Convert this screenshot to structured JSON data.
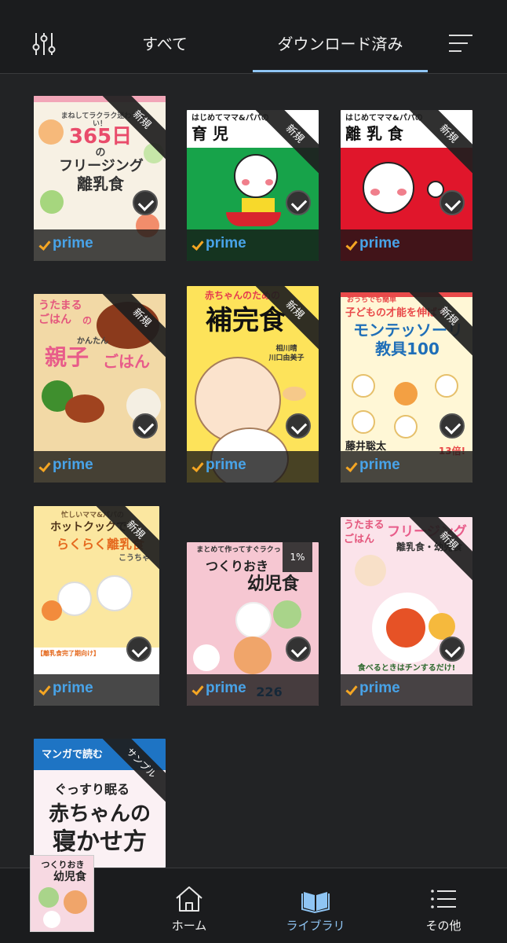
{
  "header": {
    "tabs": [
      {
        "label": "すべて",
        "active": false
      },
      {
        "label": "ダウンロード済み",
        "active": true
      }
    ],
    "accent_color": "#8fc5f4"
  },
  "books": [
    {
      "id": "b1",
      "ribbon": "新規",
      "prime": "prime",
      "downloaded": true,
      "cover_lines": [
        "まねしてラクラク迷わない！",
        "365日",
        "の",
        "フリージング",
        "離乳食"
      ],
      "cover_color": "#f7f1e4"
    },
    {
      "id": "b2",
      "ribbon": "新規",
      "prime": "prime",
      "downloaded": true,
      "cover_lines": [
        "はじめてママ&パパの",
        "育 児"
      ],
      "cover_color": "#17a34a"
    },
    {
      "id": "b3",
      "ribbon": "新規",
      "prime": "prime",
      "downloaded": true,
      "cover_lines": [
        "はじめてママ&パパの",
        "離 乳 食"
      ],
      "cover_color": "#e0162b"
    },
    {
      "id": "b4",
      "ribbon": "新規",
      "prime": "prime",
      "downloaded": true,
      "cover_lines": [
        "うたまる",
        "ごはん",
        "の",
        "かんたん",
        "親子",
        "ごはん"
      ],
      "cover_color": "#f2d9a6"
    },
    {
      "id": "b5",
      "ribbon": "新規",
      "prime": "prime",
      "downloaded": true,
      "cover_lines": [
        "赤ちゃんのための",
        "補完食",
        "相川晴",
        "川口由美子"
      ],
      "cover_color": "#fde35a"
    },
    {
      "id": "b6",
      "ribbon": "新規",
      "prime": "prime",
      "downloaded": true,
      "cover_lines": [
        "おうちでも簡単",
        "子どもの才能を伸ばす",
        "モンテッソーリ",
        "教具100",
        "藤井聡太",
        "13倍!"
      ],
      "cover_color": "#fff7d6"
    },
    {
      "id": "b7",
      "ribbon": "新規",
      "prime": "prime",
      "downloaded": true,
      "cover_lines": [
        "忙しいママ&パパの",
        "ホットクックで",
        "らくらく離乳食",
        "こうちゃ",
        "【離乳食完了期向け】"
      ],
      "cover_color": "#fbe7a0"
    },
    {
      "id": "b8",
      "ribbon": "1%",
      "prime": "prime",
      "downloaded": true,
      "cover_lines": [
        "まとめて作ってすぐラクっ",
        "つくりおき",
        "幼児食",
        "226"
      ],
      "cover_color": "#f6c7d2"
    },
    {
      "id": "b9",
      "ribbon": "新規",
      "prime": "prime",
      "downloaded": true,
      "cover_lines": [
        "うたまる",
        "ごはん",
        "フリージング",
        "離乳食・幼児食",
        "食べるときはチンするだけ!"
      ],
      "cover_color": "#fbe3ea"
    },
    {
      "id": "b10",
      "ribbon": "サンプル",
      "prime": "",
      "downloaded": false,
      "cover_lines": [
        "マンガで読む",
        "ぐっすり眠る",
        "赤ちゃんの",
        "寝かせ方"
      ],
      "cover_color": "#1e74c4"
    }
  ],
  "bottom_nav": {
    "items": [
      {
        "label": "ホーム",
        "icon": "home-icon",
        "active": false
      },
      {
        "label": "ライブラリ",
        "icon": "book-icon",
        "active": true
      },
      {
        "label": "その他",
        "icon": "menu-icon",
        "active": false
      }
    ],
    "now_reading": {
      "cover_lines": [
        "つくりおき",
        "幼児食"
      ]
    }
  }
}
